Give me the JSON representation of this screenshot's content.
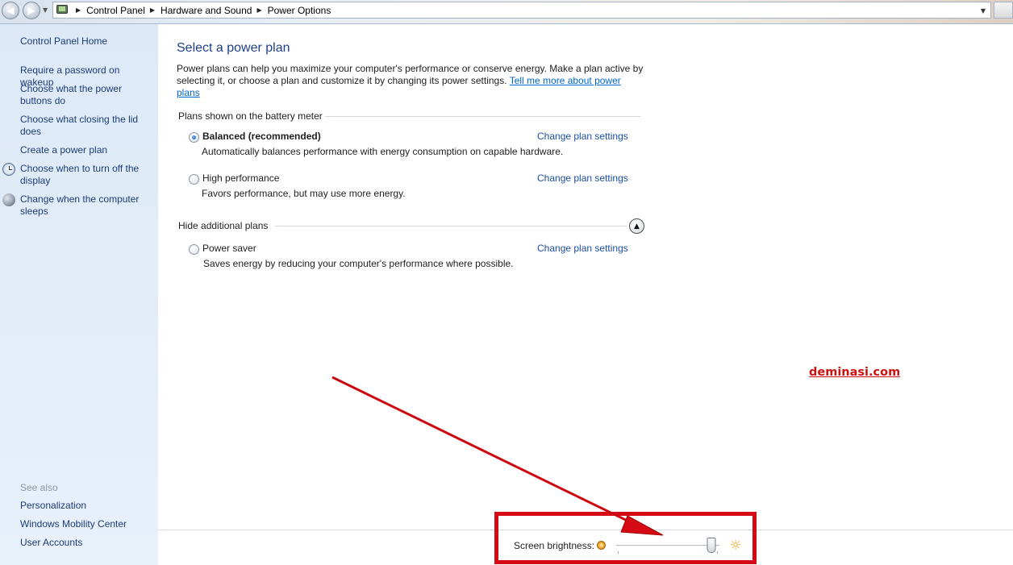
{
  "address_bar": {
    "breadcrumbs": [
      "Control Panel",
      "Hardware and Sound",
      "Power Options"
    ]
  },
  "left_pane": {
    "home": "Control Panel Home",
    "tasks": [
      "Require a password on wakeup",
      "Choose what the power buttons do",
      "Choose what closing the lid does",
      "Create a power plan",
      "Choose when to turn off the display",
      "Change when the computer sleeps"
    ],
    "see_also_title": "See also",
    "see_also": [
      "Personalization",
      "Windows Mobility Center",
      "User Accounts"
    ]
  },
  "main": {
    "title": "Select a power plan",
    "intro": "Power plans can help you maximize your computer's performance or conserve energy. Make a plan active by selecting it, or choose a plan and customize it by changing its power settings.",
    "intro_link": "Tell me more about power plans",
    "battery_meter_header": "Plans shown on the battery meter",
    "additional_header": "Hide additional plans",
    "change_link": "Change plan settings",
    "plans": [
      {
        "name": "Balanced (recommended)",
        "description": "Automatically balances performance with energy consumption on capable hardware.",
        "selected": true
      },
      {
        "name": "High performance",
        "description": "Favors performance, but may use more energy.",
        "selected": false
      },
      {
        "name": "Power saver",
        "description": "Saves energy by reducing your computer's performance where possible.",
        "selected": false
      }
    ]
  },
  "bottom": {
    "brightness_label": "Screen brightness:",
    "brightness_level": 0.92
  },
  "overlay": {
    "watermark": "deminasi.com",
    "annotation_color": "#d60a14"
  }
}
